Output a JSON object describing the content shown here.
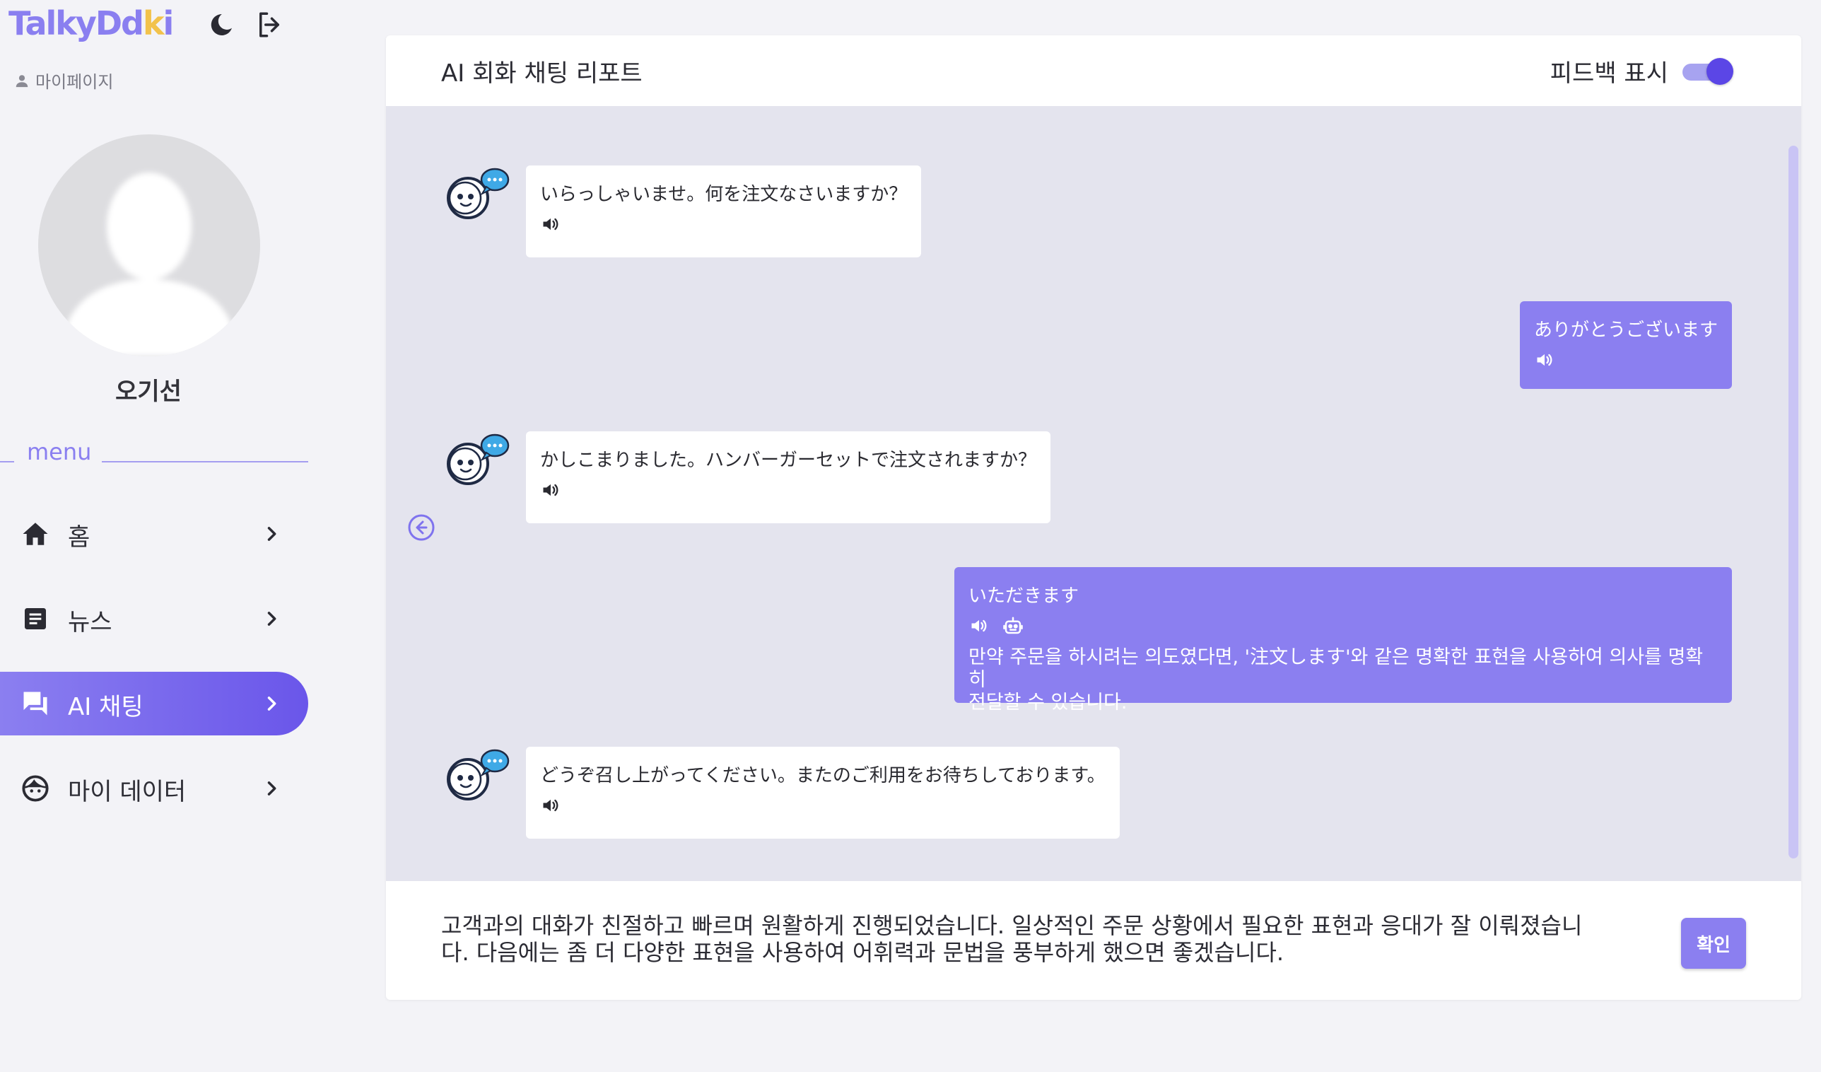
{
  "app": {
    "logo": "TalkyDdki",
    "logo_main": "TalkyDd",
    "logo_dot": "k",
    "logo_end": "i"
  },
  "sidebar": {
    "mypage_label": "마이페이지",
    "user_name": "오기선",
    "menu_title": "menu",
    "items": [
      {
        "label": "홈",
        "icon": "home-icon",
        "active": false
      },
      {
        "label": "뉴스",
        "icon": "article-icon",
        "active": false
      },
      {
        "label": "AI 채팅",
        "icon": "chat-icon",
        "active": true
      },
      {
        "label": "마이 데이터",
        "icon": "face-icon",
        "active": false
      }
    ]
  },
  "header": {
    "title": "AI 회화 채팅 리포트",
    "feedback_toggle_label": "피드백 표시",
    "feedback_toggle_on": true
  },
  "messages": [
    {
      "role": "bot",
      "text": "いらっしゃいませ。何を注文なさいますか？"
    },
    {
      "role": "user",
      "text": "ありがとうございます"
    },
    {
      "role": "bot",
      "text": "かしこまりました。ハンバーガーセットで注文されますか？"
    },
    {
      "role": "user",
      "text": "いただきます",
      "feedback_line1": "만약 주문을 하시려는 의도였다면, '注文します'와 같은 명확한 표현을 사용하여 의사를 명확히",
      "feedback_line2": "전달할 수 있습니다."
    },
    {
      "role": "bot",
      "text": "どうぞ召し上がってください。またのご利用をお待ちしております。"
    }
  ],
  "summary": {
    "line1": "고객과의 대화가 친절하고 빠르며 원활하게 진행되었습니다. 일상적인 주문 상황에서 필요한 표현과 응대가 잘 이뤄졌습니",
    "line2": "다. 다음에는 좀 더 다양한 표현을 사용하여 어휘력과 문법을 풍부하게 했으면 좋겠습니다.",
    "confirm_label": "확인"
  },
  "colors": {
    "accent": "#8b7ff0",
    "accent_dark": "#5b46e6",
    "chat_bg": "#e4e4ee",
    "page_bg": "#f3f3f7"
  }
}
